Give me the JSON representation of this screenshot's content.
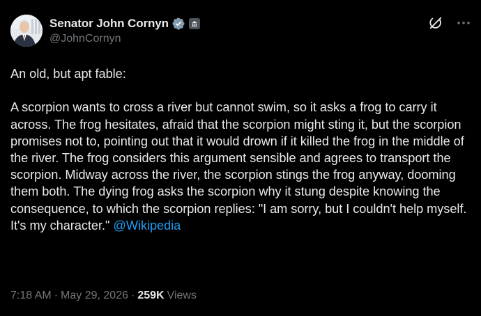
{
  "author": {
    "display_name": "Senator John Cornyn",
    "handle": "@JohnCornyn",
    "avatar_icon": "senator-portrait-avatar",
    "verified_icon": "verified-badge-icon",
    "verified_color": "#829aab",
    "affiliation_icon": "government-building-icon"
  },
  "header_actions": {
    "grok_icon": "grok-icon",
    "more_icon": "more-options-icon"
  },
  "post": {
    "intro": "An old, but apt fable:",
    "text": "A scorpion wants to cross a river but cannot swim, so it asks a frog to carry it across. The frog hesitates, afraid that the scorpion might sting it, but the scorpion promises not to, pointing out that it would drown if it killed the frog in the middle of the river. The frog considers this argument sensible and agrees to transport the scorpion. Midway across the river, the scorpion stings the frog anyway, dooming them both. The dying frog asks the scorpion why it stung despite knowing the consequence, to which the scorpion replies: \"I am sorry, but I couldn't help myself. It's my character.\"",
    "mention": "@Wikipedia"
  },
  "meta": {
    "time": "7:18 AM",
    "separator": "·",
    "date": "May 29, 2026",
    "views_count": "259K",
    "views_label": "Views"
  },
  "colors": {
    "background": "#000000",
    "text_primary": "#e7e9ea",
    "text_secondary": "#71767b",
    "link": "#1d9bf0"
  }
}
